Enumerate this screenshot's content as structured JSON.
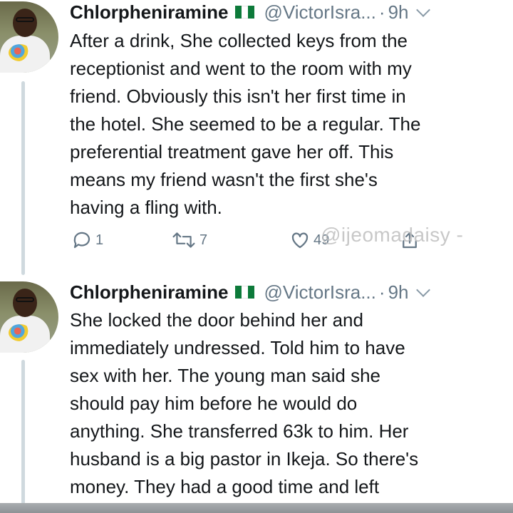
{
  "tweets": [
    {
      "display_name": "Chlorpheniramine",
      "flag_icon": "nigeria-flag-icon",
      "handle": "@VictorIsra...",
      "separator": "·",
      "time": "9h",
      "text_lines": [
        "After a drink, She collected keys from the",
        "receptionist and went to the room with my",
        "friend. Obviously this isn't her first time in",
        "the hotel. She seemed to be a regular. The",
        "preferential treatment gave her off. This",
        "means my friend wasn't the first she's",
        "having a fling with."
      ],
      "actions": {
        "reply_count": "1",
        "retweet_count": "7",
        "like_count": "49"
      }
    },
    {
      "display_name": "Chlorpheniramine",
      "flag_icon": "nigeria-flag-icon",
      "handle": "@VictorIsra...",
      "separator": "·",
      "time": "9h",
      "text_lines": [
        "She locked the door behind her and",
        "immediately undressed. Told him to have",
        "sex with her. The young man said she",
        "should pay him before he would do",
        "anything. She transferred 63k to him. Her",
        "husband is a big pastor in Ikeja. So there's",
        "money. They had a good time and left"
      ]
    }
  ],
  "watermark": "@ijeomadaisy -",
  "colors": {
    "text": "#14171a",
    "muted": "#657786",
    "thread_line": "#cfd9de",
    "flag_green": "#0d7a3a"
  }
}
